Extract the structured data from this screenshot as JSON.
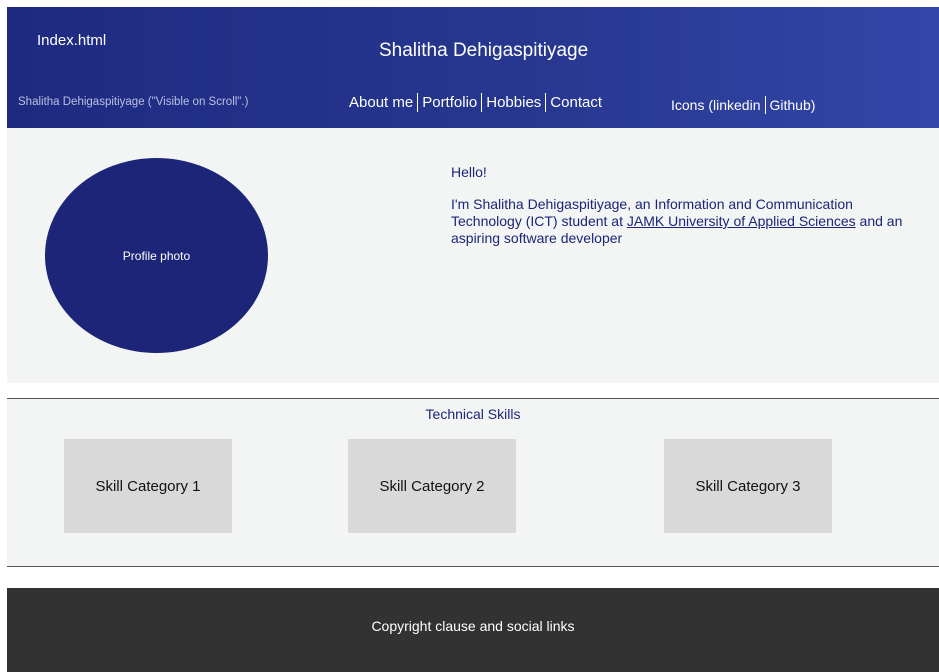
{
  "header": {
    "filename": "Index.html",
    "title": "Shalitha Dehigaspitiyage",
    "scroll_name": "Shalitha Dehigaspitiyage (\"Visible on Scroll\".)",
    "nav": [
      "About me",
      "Portfolio",
      "Hobbies",
      "Contact"
    ],
    "icons": [
      "Icons (linkedin",
      "Github)"
    ],
    "colors": {
      "gradient_start": "#1d2a80",
      "gradient_end": "#3346a8"
    }
  },
  "intro": {
    "photo_label": "Profile photo",
    "hello": "Hello!",
    "bio_before_link": "I'm Shalitha Dehigaspitiyage, an Information and Communication Technology (ICT) student at ",
    "bio_link": "JAMK University of Applied Sciences",
    "bio_after_link": " and an aspiring software developer",
    "accent_color": "#1c2577"
  },
  "skills": {
    "title": "Technical Skills",
    "categories": [
      "Skill Category 1",
      "Skill Category 2",
      "Skill Category 3"
    ]
  },
  "footer": {
    "text": "Copyright clause and social links",
    "background": "#323232"
  }
}
